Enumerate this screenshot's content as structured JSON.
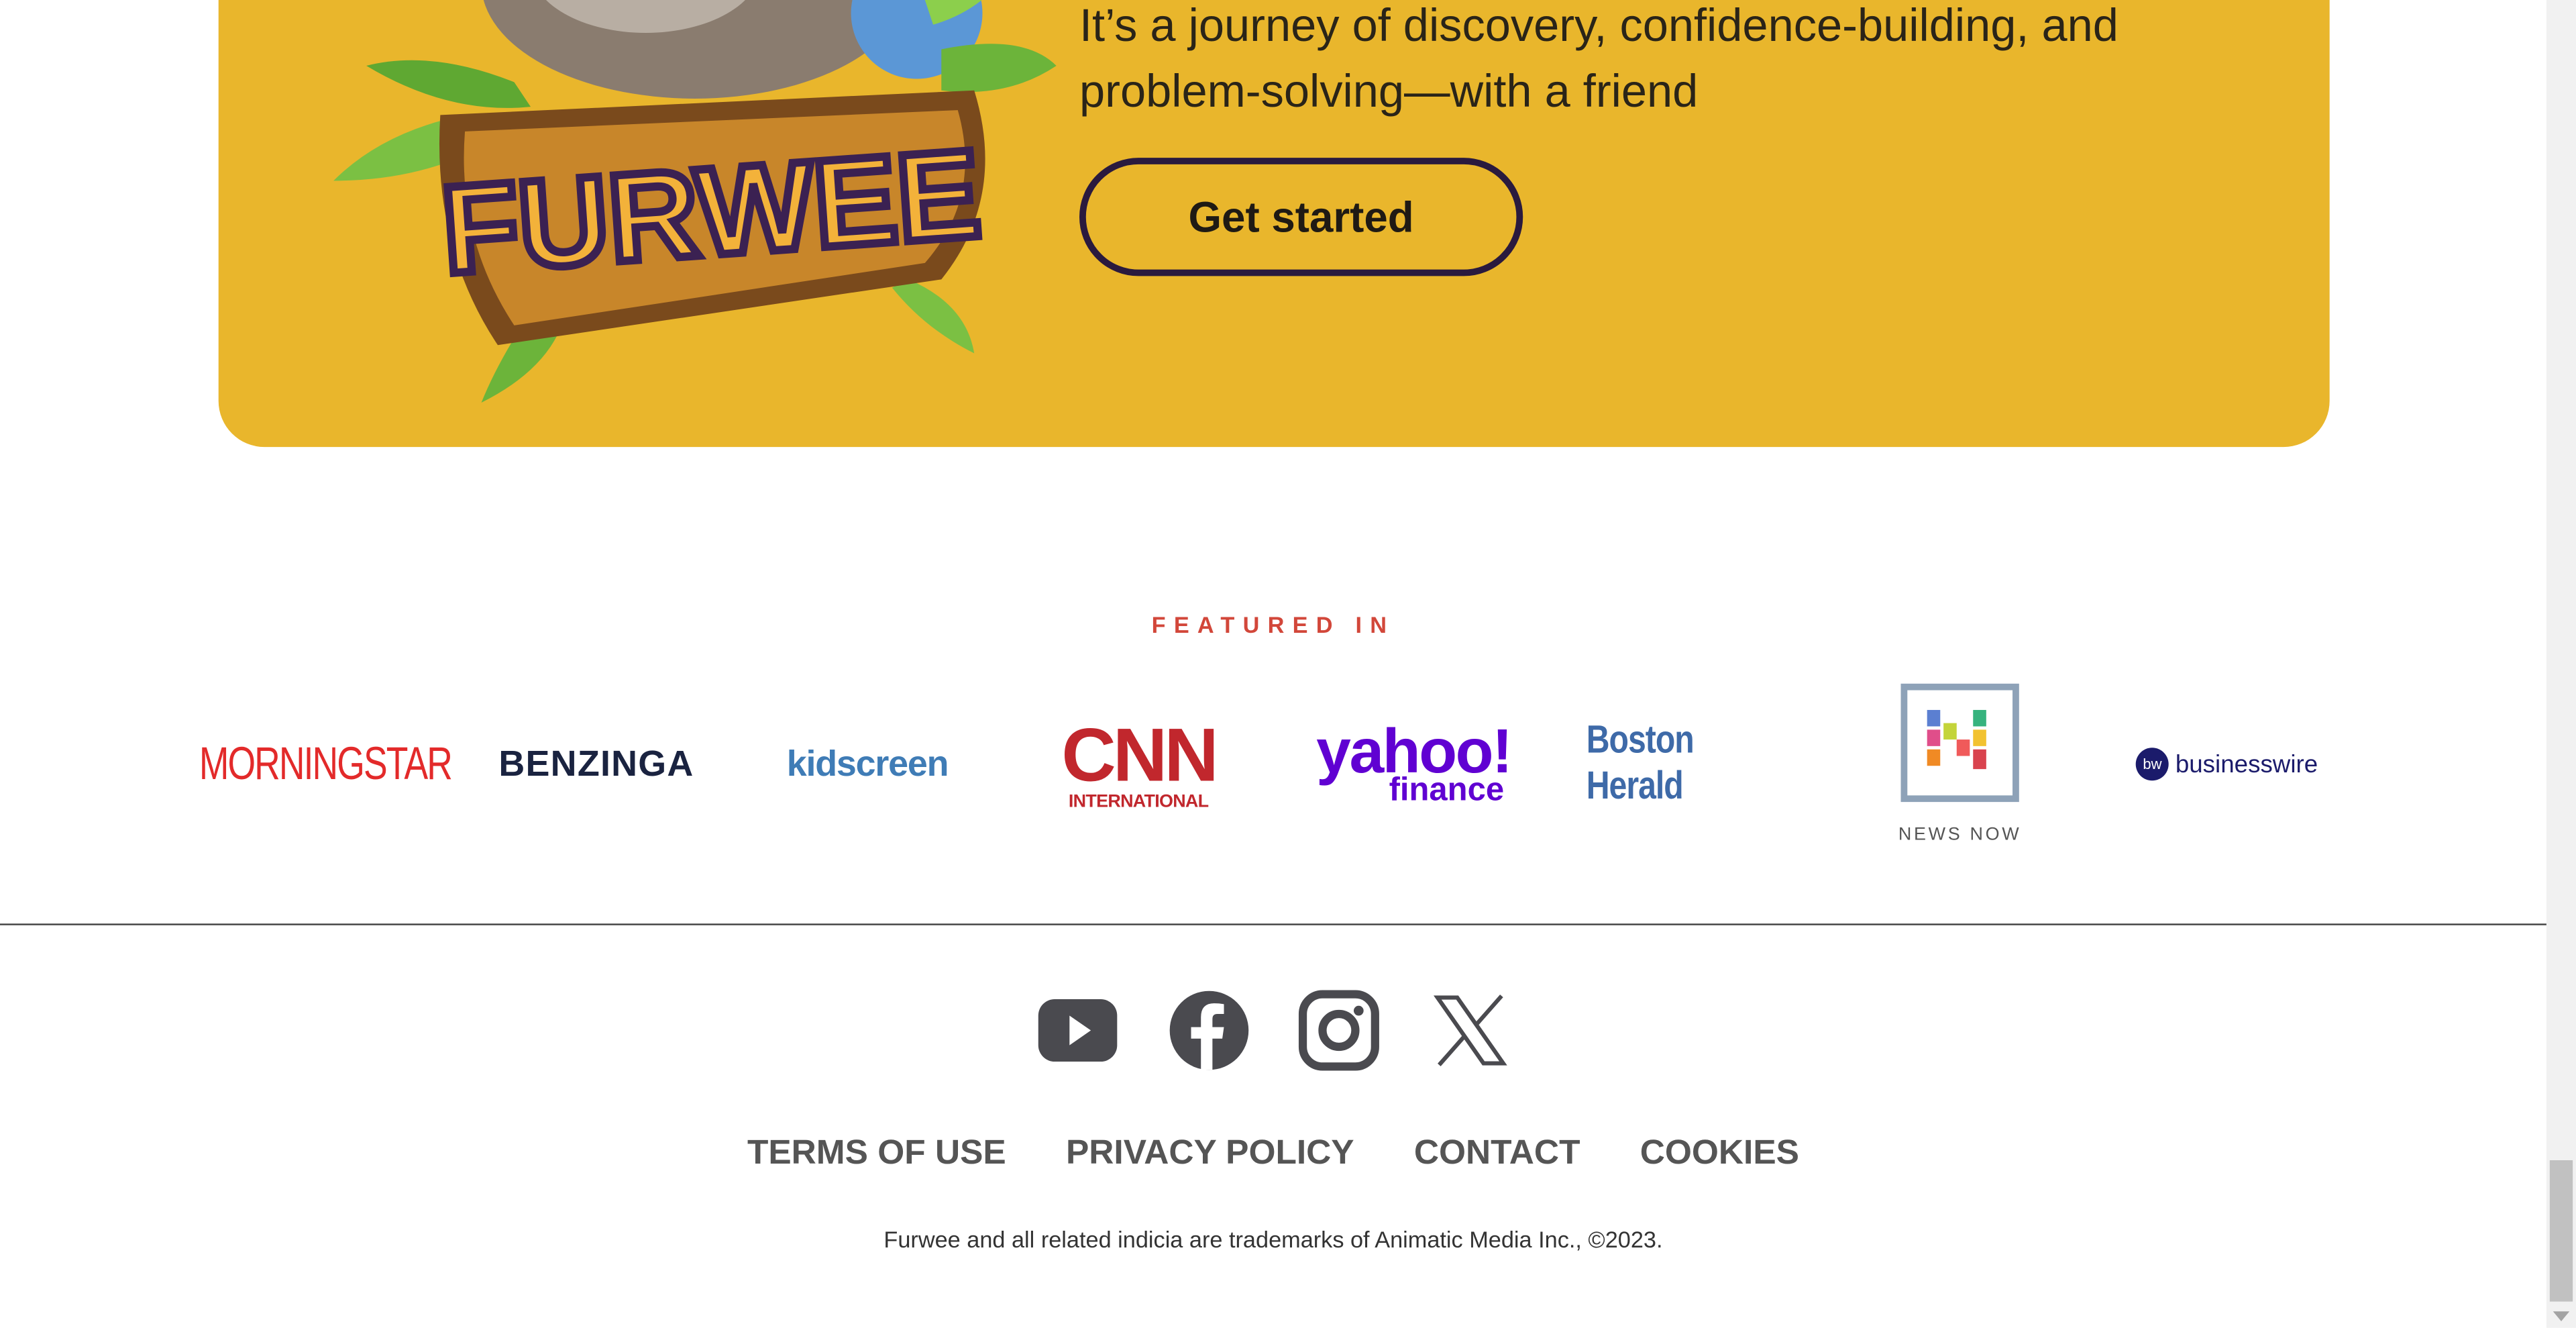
{
  "hero": {
    "text": "It’s a journey of discovery, confidence-building, and problem-solving—with a friend",
    "cta_label": "Get started",
    "logo_text": "FURWEE"
  },
  "featured": {
    "title": "FEATURED IN",
    "logos": {
      "morningstar": "MORNINGSTAR",
      "benzinga": "BENZINGA",
      "kidscreen": "kidscreen",
      "cnn_main": "CNN",
      "cnn_sub": "INTERNATIONAL",
      "yahoo_main": "yahoo!",
      "yahoo_sub": "finance",
      "boston": "Boston Herald",
      "newsnow": "NEWS NOW",
      "businesswire": "businesswire",
      "businesswire_badge": "bw"
    }
  },
  "social": [
    "youtube-icon",
    "facebook-icon",
    "instagram-icon",
    "x-icon"
  ],
  "footer": {
    "links": [
      "TERMS OF USE",
      "PRIVACY POLICY",
      "CONTACT",
      "COOKIES"
    ],
    "copyright": "Furwee and all related indicia are trademarks of Animatic Media Inc., ©2023."
  },
  "colors": {
    "hero_bg": "#e9b62c",
    "accent_red": "#d2473a",
    "button_border": "#2a1a3e"
  }
}
